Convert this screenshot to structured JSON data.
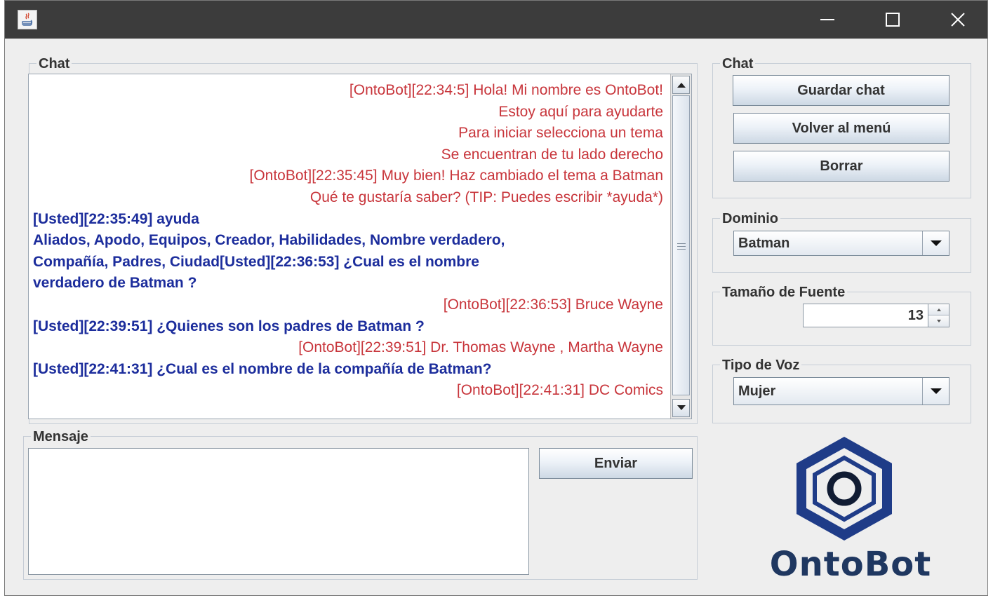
{
  "window": {
    "controls": {
      "minimize": "minimize-icon",
      "maximize": "maximize-icon",
      "close": "close-icon"
    }
  },
  "colors": {
    "bot_text": "#c8353b",
    "user_text": "#1c2d9c",
    "logo": "#1f3760",
    "titlebar": "#3c3c3c"
  },
  "chat_panel": {
    "legend": "Chat",
    "lines": [
      {
        "speaker": "bot",
        "text": "[OntoBot][22:34:5] Hola! Mi nombre es OntoBot!"
      },
      {
        "speaker": "bot",
        "text": "Estoy aquí para ayudarte"
      },
      {
        "speaker": "bot",
        "text": "Para iniciar selecciona un tema"
      },
      {
        "speaker": "bot",
        "text": "Se encuentran de tu lado derecho"
      },
      {
        "speaker": "bot",
        "text": "[OntoBot][22:35:45] Muy bien! Haz cambiado el tema a Batman"
      },
      {
        "speaker": "bot",
        "text": "Qué te gustaría saber? (TIP: Puedes escribir *ayuda*)"
      },
      {
        "speaker": "user",
        "text": "[Usted][22:35:49] ayuda"
      },
      {
        "speaker": "user",
        "text": "Aliados, Apodo, Equipos, Creador, Habilidades, Nombre verdadero,"
      },
      {
        "speaker": "user",
        "text": "Compañía, Padres, Ciudad[Usted][22:36:53] ¿Cual es el nombre"
      },
      {
        "speaker": "user",
        "text": "verdadero de Batman ?"
      },
      {
        "speaker": "bot",
        "text": "[OntoBot][22:36:53] Bruce Wayne"
      },
      {
        "speaker": "user",
        "text": "[Usted][22:39:51] ¿Quienes son los padres de Batman ?"
      },
      {
        "speaker": "bot",
        "text": "[OntoBot][22:39:51] Dr. Thomas Wayne , Martha Wayne"
      },
      {
        "speaker": "user",
        "text": "[Usted][22:41:31] ¿Cual es el nombre de la compañía de Batman?"
      },
      {
        "speaker": "bot",
        "text": "[OntoBot][22:41:31] DC Comics"
      }
    ]
  },
  "message_panel": {
    "legend": "Mensaje",
    "input_value": "",
    "send_label": "Enviar"
  },
  "side_chat": {
    "legend": "Chat",
    "save_label": "Guardar chat",
    "back_label": "Volver al menú",
    "clear_label": "Borrar"
  },
  "domain": {
    "legend": "Dominio",
    "selected": "Batman"
  },
  "font_size": {
    "legend": "Tamaño de Fuente",
    "value": "13"
  },
  "voice": {
    "legend": "Tipo de Voz",
    "selected": "Mujer"
  },
  "logo": {
    "text": "OntoBot"
  }
}
